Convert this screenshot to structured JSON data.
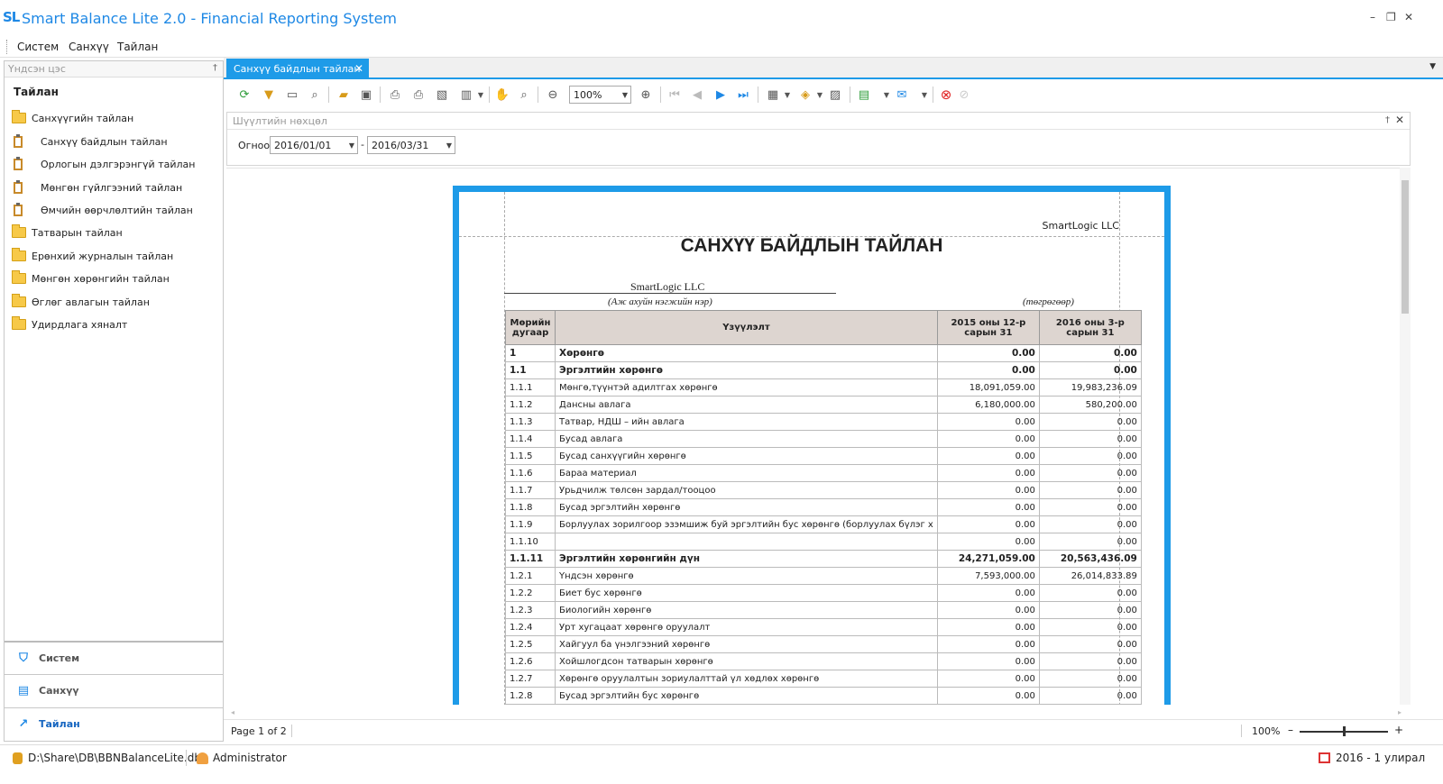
{
  "app": {
    "logo": "SL",
    "title": "Smart Balance Lite 2.0 - Financial Reporting System",
    "window_buttons": [
      "–",
      "❐",
      "✕"
    ]
  },
  "menu": {
    "items": [
      "Систем",
      "Санхүү",
      "Тайлан"
    ]
  },
  "sidebar": {
    "header": "Үндсэн цэс",
    "pin": "†",
    "section": "Тайлан",
    "tree": [
      {
        "label": "Санхүүгийн тайлан",
        "type": "folder"
      },
      {
        "label": "Санхүү байдлын тайлан",
        "type": "report"
      },
      {
        "label": "Орлогын дэлгэрэнгүй тайлан",
        "type": "report"
      },
      {
        "label": "Мөнгөн гүйлгээний тайлан",
        "type": "report"
      },
      {
        "label": "Өмчийн өөрчлөлтийн тайлан",
        "type": "report"
      },
      {
        "label": "Татварын тайлан",
        "type": "folder"
      },
      {
        "label": "Ерөнхий журналын тайлан",
        "type": "folder"
      },
      {
        "label": "Мөнгөн хөрөнгийн тайлан",
        "type": "folder"
      },
      {
        "label": "Өглөг авлагын тайлан",
        "type": "folder"
      },
      {
        "label": "Удирдлага хяналт",
        "type": "folder"
      }
    ],
    "nav": [
      {
        "label": "Систем",
        "icon": "shield-icon"
      },
      {
        "label": "Санхүү",
        "icon": "clipboard-icon"
      },
      {
        "label": "Тайлан",
        "icon": "chart-icon"
      }
    ]
  },
  "tab": {
    "label": "Санхүү байдлын тайлан",
    "close": "✕",
    "menu": "▼"
  },
  "toolbar": {
    "zoom": "100%"
  },
  "filter": {
    "title": "Шүүлтийн нөхцөл",
    "date_label": "Огноо",
    "date_from": "2016/01/01",
    "date_to": "2016/03/31",
    "dash": "-",
    "pin": "†",
    "close": "✕"
  },
  "report": {
    "company_top": "SmartLogic LLC",
    "title": "САНХҮҮ БАЙДЛЫН ТАЙЛАН",
    "company_name": "SmartLogic LLC",
    "company_caption": "(Аж ахуйн нэгжийн нэр)",
    "currency_caption": "(төгрөгөөр)",
    "columns": [
      "Мөрийн дугаар",
      "Үзүүлэлт",
      "2015 оны 12-р сарын 31",
      "2016 оны 3-р сарын 31"
    ],
    "rows": [
      {
        "no": "1",
        "name": "Хөрөнгө",
        "v1": "0.00",
        "v2": "0.00",
        "bold": true
      },
      {
        "no": "1.1",
        "name": "Эргэлтийн хөрөнгө",
        "v1": "0.00",
        "v2": "0.00",
        "bold": true
      },
      {
        "no": "1.1.1",
        "name": "Мөнгө,түүнтэй адилтгах хөрөнгө",
        "v1": "18,091,059.00",
        "v2": "19,983,236.09"
      },
      {
        "no": "1.1.2",
        "name": "Дансны авлага",
        "v1": "6,180,000.00",
        "v2": "580,200.00"
      },
      {
        "no": "1.1.3",
        "name": "Татвар, НДШ – ийн авлага",
        "v1": "0.00",
        "v2": "0.00"
      },
      {
        "no": "1.1.4",
        "name": "Бусад авлага",
        "v1": "0.00",
        "v2": "0.00"
      },
      {
        "no": "1.1.5",
        "name": "Бусад санхүүгийн хөрөнгө",
        "v1": "0.00",
        "v2": "0.00"
      },
      {
        "no": "1.1.6",
        "name": "Бараа материал",
        "v1": "0.00",
        "v2": "0.00"
      },
      {
        "no": "1.1.7",
        "name": "Урьдчилж төлсөн зардал/тооцоо",
        "v1": "0.00",
        "v2": "0.00"
      },
      {
        "no": "1.1.8",
        "name": "Бусад эргэлтийн хөрөнгө",
        "v1": "0.00",
        "v2": "0.00"
      },
      {
        "no": "1.1.9",
        "name": "Борлуулах зорилгоор эзэмшиж буй эргэлтийн бус хөрөнгө (борлуулах бүлэг х",
        "v1": "0.00",
        "v2": "0.00"
      },
      {
        "no": "1.1.10",
        "name": "",
        "v1": "0.00",
        "v2": "0.00"
      },
      {
        "no": "1.1.11",
        "name": "Эргэлтийн хөрөнгийн дүн",
        "v1": "24,271,059.00",
        "v2": "20,563,436.09",
        "bold": true
      },
      {
        "no": "1.2.1",
        "name": "Үндсэн хөрөнгө",
        "v1": "7,593,000.00",
        "v2": "26,014,833.89"
      },
      {
        "no": "1.2.2",
        "name": "Биет бус хөрөнгө",
        "v1": "0.00",
        "v2": "0.00"
      },
      {
        "no": "1.2.3",
        "name": "Биологийн хөрөнгө",
        "v1": "0.00",
        "v2": "0.00"
      },
      {
        "no": "1.2.4",
        "name": "Урт хугацаат хөрөнгө оруулалт",
        "v1": "0.00",
        "v2": "0.00"
      },
      {
        "no": "1.2.5",
        "name": "Хайгуул ба үнэлгээний хөрөнгө",
        "v1": "0.00",
        "v2": "0.00"
      },
      {
        "no": "1.2.6",
        "name": "Хойшлогдсон татварын хөрөнгө",
        "v1": "0.00",
        "v2": "0.00"
      },
      {
        "no": "1.2.7",
        "name": "Хөрөнгө оруулалтын зориулалттай үл хөдлөх хөрөнгө",
        "v1": "0.00",
        "v2": "0.00"
      },
      {
        "no": "1.2.8",
        "name": "Бусад эргэлтийн бус хөрөнгө",
        "v1": "0.00",
        "v2": "0.00"
      }
    ]
  },
  "preview_status": {
    "page_info": "Page 1 of 2",
    "zoom": "100%",
    "zoom_minus": "–",
    "zoom_plus": "+",
    "zoom_level": 0.5
  },
  "status": {
    "db_path": "D:\\Share\\DB\\BBNBalanceLite.db",
    "user": "Administrator",
    "period": "2016 - 1 улирал"
  },
  "colors": {
    "accent": "#1e9be8",
    "title": "#1e88e5",
    "header_bg": "#ddd5d0",
    "close_red": "#e02020"
  }
}
